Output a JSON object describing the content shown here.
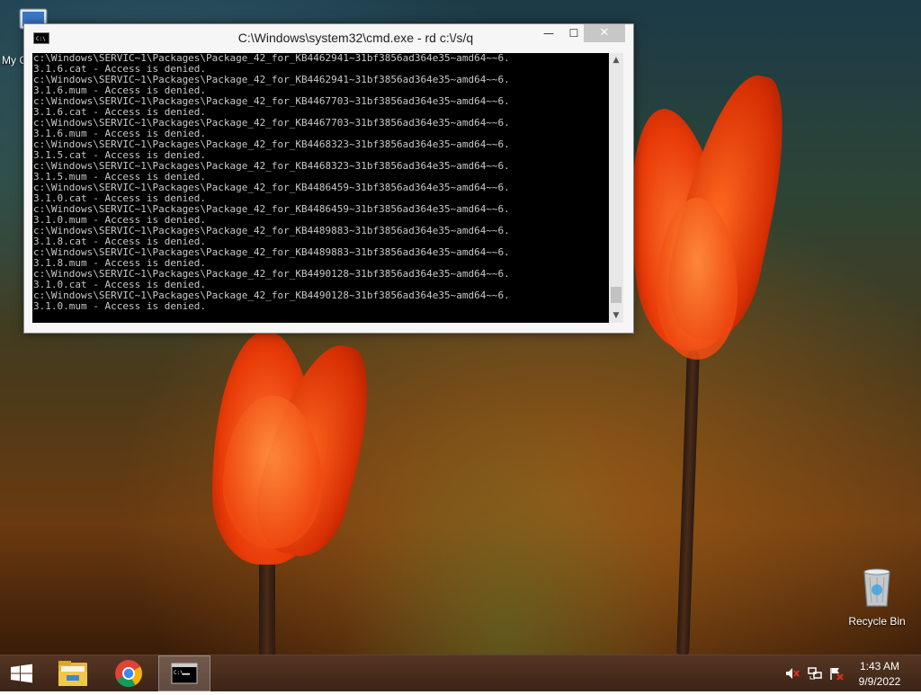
{
  "desktop": {
    "icons": [
      {
        "label": "My C"
      },
      {
        "label": "Recycle Bin"
      }
    ]
  },
  "cmd": {
    "title": "C:\\Windows\\system32\\cmd.exe - rd  c:\\/s/q",
    "controls": {
      "minimize": "—",
      "maximize": "☐",
      "close": "✕"
    },
    "lines": [
      "c:\\Windows\\SERVIC~1\\Packages\\Package_42_for_KB4462941~31bf3856ad364e35~amd64~~6.",
      "3.1.6.cat - Access is denied.",
      "c:\\Windows\\SERVIC~1\\Packages\\Package_42_for_KB4462941~31bf3856ad364e35~amd64~~6.",
      "3.1.6.mum - Access is denied.",
      "c:\\Windows\\SERVIC~1\\Packages\\Package_42_for_KB4467703~31bf3856ad364e35~amd64~~6.",
      "3.1.6.cat - Access is denied.",
      "c:\\Windows\\SERVIC~1\\Packages\\Package_42_for_KB4467703~31bf3856ad364e35~amd64~~6.",
      "3.1.6.mum - Access is denied.",
      "c:\\Windows\\SERVIC~1\\Packages\\Package_42_for_KB4468323~31bf3856ad364e35~amd64~~6.",
      "3.1.5.cat - Access is denied.",
      "c:\\Windows\\SERVIC~1\\Packages\\Package_42_for_KB4468323~31bf3856ad364e35~amd64~~6.",
      "3.1.5.mum - Access is denied.",
      "c:\\Windows\\SERVIC~1\\Packages\\Package_42_for_KB4486459~31bf3856ad364e35~amd64~~6.",
      "3.1.0.cat - Access is denied.",
      "c:\\Windows\\SERVIC~1\\Packages\\Package_42_for_KB4486459~31bf3856ad364e35~amd64~~6.",
      "3.1.0.mum - Access is denied.",
      "c:\\Windows\\SERVIC~1\\Packages\\Package_42_for_KB4489883~31bf3856ad364e35~amd64~~6.",
      "3.1.8.cat - Access is denied.",
      "c:\\Windows\\SERVIC~1\\Packages\\Package_42_for_KB4489883~31bf3856ad364e35~amd64~~6.",
      "3.1.8.mum - Access is denied.",
      "c:\\Windows\\SERVIC~1\\Packages\\Package_42_for_KB4490128~31bf3856ad364e35~amd64~~6.",
      "3.1.0.cat - Access is denied.",
      "c:\\Windows\\SERVIC~1\\Packages\\Package_42_for_KB4490128~31bf3856ad364e35~amd64~~6.",
      "3.1.0.mum - Access is denied."
    ],
    "scroll": {
      "up": "▲",
      "down": "▼"
    }
  },
  "taskbar": {
    "buttons": [
      {
        "icon": "windows-logo-icon"
      },
      {
        "icon": "file-explorer-icon"
      },
      {
        "icon": "chrome-icon"
      },
      {
        "icon": "command-prompt-icon"
      }
    ],
    "tray": [
      {
        "icon": "speaker-muted-icon"
      },
      {
        "icon": "network-icon"
      },
      {
        "icon": "action-center-flag-icon"
      }
    ],
    "clock": {
      "time": "1:43 AM",
      "date": "9/9/2022"
    }
  },
  "colors": {
    "console_bg": "#000000",
    "console_text": "#c8c8c8",
    "tulip": "#ff4a10"
  }
}
